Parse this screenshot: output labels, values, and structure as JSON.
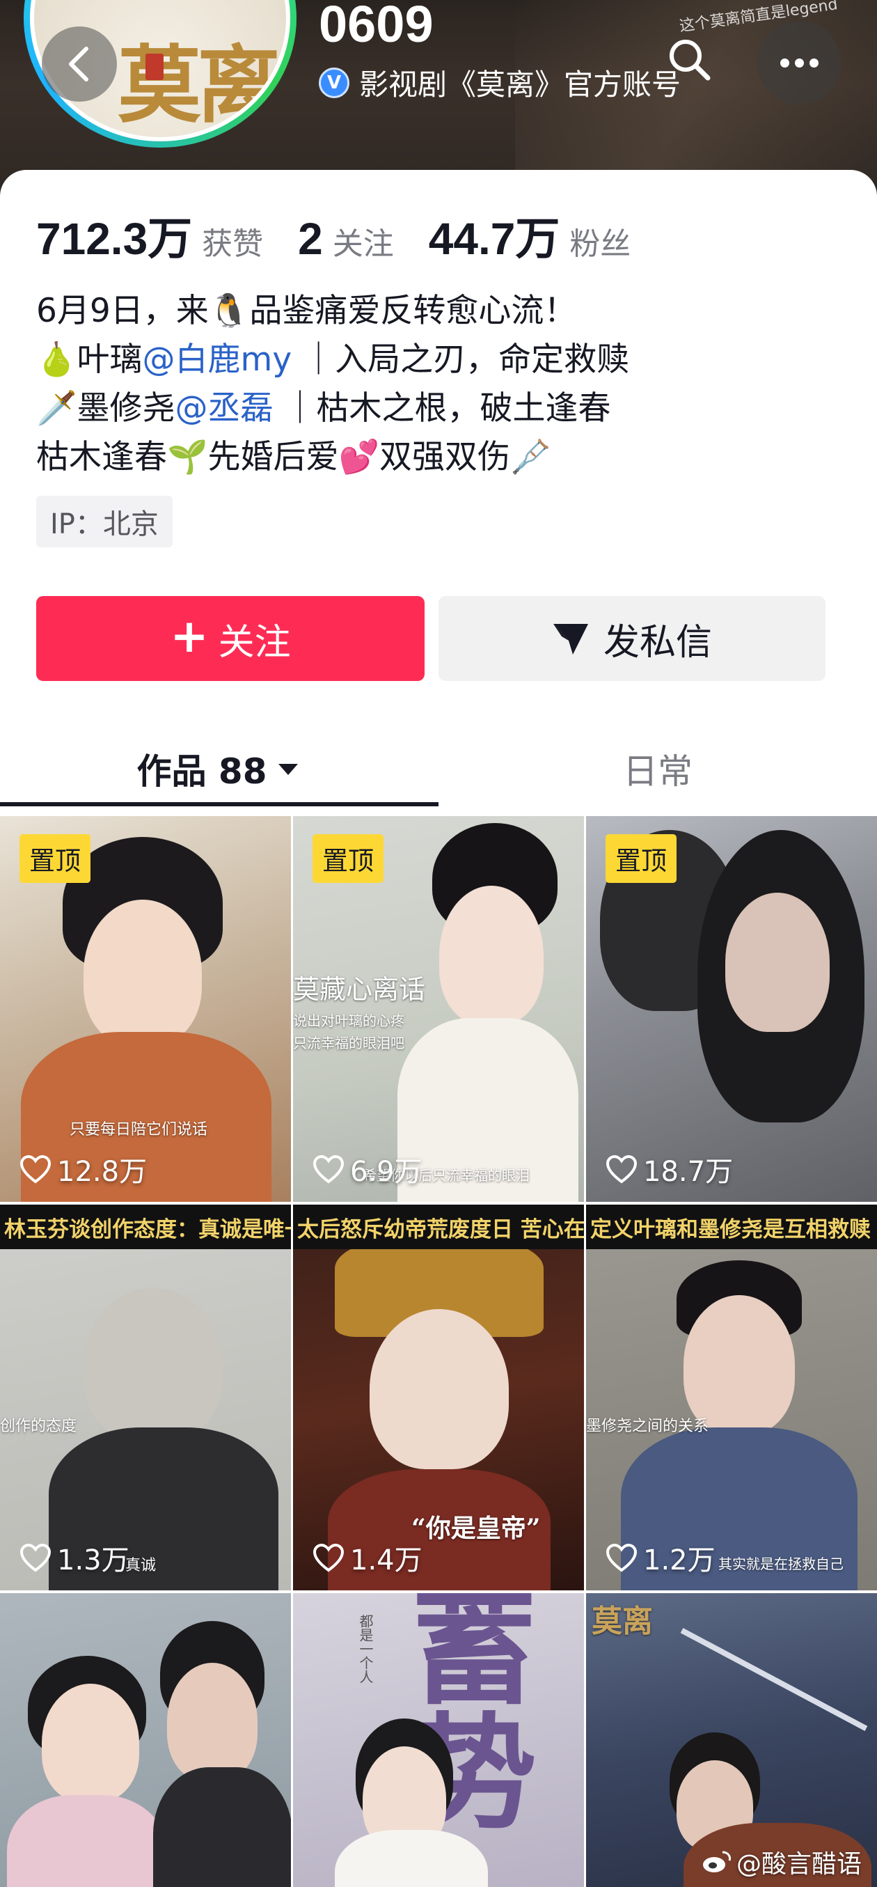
{
  "header": {
    "handle": "0609",
    "verified_label": "影视剧《莫离》官方账号",
    "avatar_logo_text": "莫离",
    "cover_caption": "这个莫离简直是legend"
  },
  "stats": [
    {
      "value": "712.3万",
      "label": "获赞"
    },
    {
      "value": "2",
      "label": "关注"
    },
    {
      "value": "44.7万",
      "label": "粉丝"
    }
  ],
  "bio": {
    "line1": "6月9日，来🐧品鉴痛爱反转愈心流！",
    "line2_prefix": "🍐叶璃",
    "line2_mention": "@白鹿my",
    "line2_suffix": " ｜入局之刃，命定救赎",
    "line3_prefix": "🗡️墨修尧",
    "line3_mention": "@丞磊",
    "line3_suffix": " ｜枯木之根，破土逢春",
    "line4": "枯木逢春🌱先婚后爱💕双强双伤🩼"
  },
  "ip_tag": "IP：北京",
  "actions": {
    "follow_label": "关注",
    "message_label": "发私信"
  },
  "tabs": {
    "works_label": "作品 88",
    "daily_label": "日常"
  },
  "videos": [
    {
      "pinned": true,
      "pin_label": "置顶",
      "likes": "12.8万",
      "caption": "只要每日陪它们说话"
    },
    {
      "pinned": true,
      "pin_label": "置顶",
      "likes": "6.9万",
      "title": "莫藏心离话",
      "sub1": "说出对叶璃的心疼",
      "sub2": "只流幸福的眼泪吧",
      "caption": "希望你以后只流幸福的眼泪"
    },
    {
      "pinned": true,
      "pin_label": "置顶",
      "likes": "18.7万"
    },
    {
      "pinned": false,
      "likes": "1.3万",
      "headline": "林玉芬谈创作态度：真诚是唯一原则",
      "side_text": "创作的态度",
      "caption": "真诚"
    },
    {
      "pinned": false,
      "likes": "1.4万",
      "headline": "太后怒斥幼帝荒废度日 苦心在孩子",
      "quote": "“你是皇帝”"
    },
    {
      "pinned": false,
      "likes": "1.2万",
      "headline": "定义叶璃和墨修尧是互相救赎",
      "side_text": "墨修尧之间的关系",
      "caption": "其实就是在拯救自己"
    },
    {
      "pinned": false
    },
    {
      "pinned": false,
      "big_text": "蓄势",
      "small_text": "都是一个人"
    },
    {
      "pinned": false,
      "logo_text": "莫离"
    }
  ],
  "watermark": "@酸言醋语",
  "colors": {
    "follow_button": "#fe2c55",
    "mention": "#2a62c8",
    "pin_badge": "#fdd835",
    "verified": "#3a8dff"
  }
}
